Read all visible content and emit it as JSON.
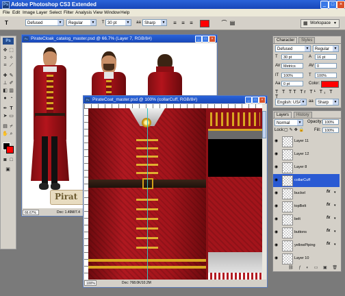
{
  "app": {
    "title": "Adobe Photoshop CS3 Extended"
  },
  "menu": [
    "File",
    "Edit",
    "Image",
    "Layer",
    "Select",
    "Filter",
    "Analysis",
    "View",
    "Window",
    "Help"
  ],
  "options_bar": {
    "tool_glyph": "T",
    "font_family": "Defused",
    "font_style": "Regular",
    "font_size": "30 pt",
    "antialias_glyph": "aa",
    "antialias": "Sharp",
    "color_hex": "#ff0000",
    "workspace_label": "Workspace"
  },
  "doc_catalog": {
    "title": "PirateCloak_catalog_master.psd @ 66.7% (Layer 7, RGB/8#)",
    "zoom": "66.67%",
    "doc_size": "Doc: 1.49M/7.4",
    "logo_text": "Pirat"
  },
  "doc_coat": {
    "title": "PirateCoat_master.psd @ 100% (collarCuff, RGB/8#)",
    "zoom": "100%",
    "doc_size": "Doc: 768.0K/10.2M"
  },
  "character_panel": {
    "tabs": [
      "Character",
      "Styles"
    ],
    "font_family": "Defused",
    "font_style": "Regular",
    "size": "30 pt",
    "leading": "16 pt",
    "kerning": "Metrics",
    "tracking": "0",
    "vscale": "100%",
    "hscale": "100%",
    "baseline": "0 pt",
    "color_label": "Color:",
    "color_hex": "#ff0000",
    "language": "English: USA",
    "antialias_glyph": "aa",
    "antialias": "Sharp"
  },
  "layers_panel": {
    "tabs": [
      "Layers",
      "History"
    ],
    "blend_mode": "Normal",
    "opacity_label": "Opacity:",
    "opacity": "100%",
    "lock_label": "Lock:",
    "fill_label": "Fill:",
    "fill": "100%",
    "layers": [
      {
        "name": "Layer 11",
        "fx": false,
        "selected": false
      },
      {
        "name": "Layer 12",
        "fx": false,
        "selected": false
      },
      {
        "name": "Layer 8",
        "fx": false,
        "selected": false
      },
      {
        "name": "collarCuff",
        "fx": false,
        "selected": true
      },
      {
        "name": "buckel",
        "fx": true,
        "selected": false
      },
      {
        "name": "topBelt",
        "fx": true,
        "selected": false
      },
      {
        "name": "belt",
        "fx": true,
        "selected": false
      },
      {
        "name": "buttons",
        "fx": true,
        "selected": false
      },
      {
        "name": "yellowPiping",
        "fx": true,
        "selected": false
      },
      {
        "name": "Layer 10",
        "fx": false,
        "selected": false
      }
    ],
    "fx_label": "fx"
  }
}
